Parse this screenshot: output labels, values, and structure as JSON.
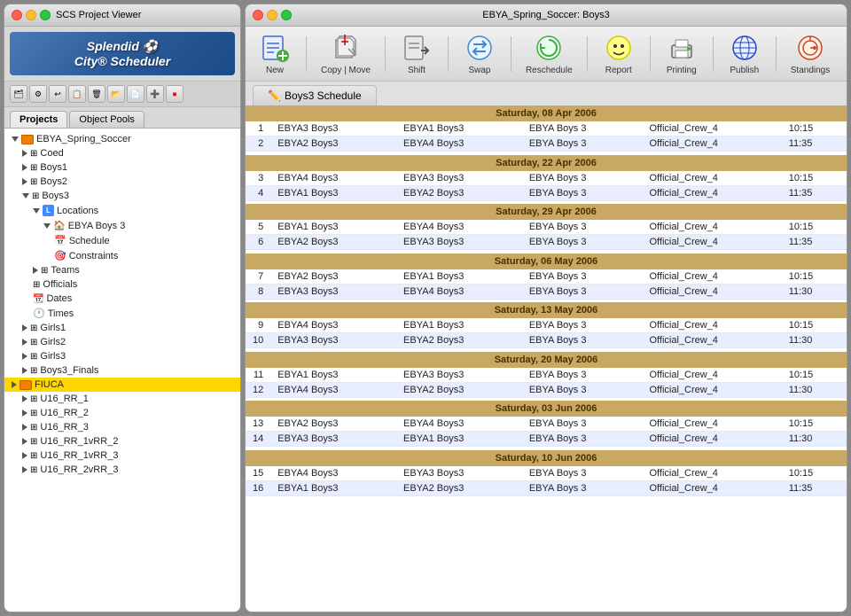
{
  "leftPanel": {
    "title": "SCS Project Viewer",
    "appName": "Splendid",
    "appName2": "City® Scheduler",
    "tabs": [
      "Projects",
      "Object Pools"
    ],
    "activeTab": "Projects",
    "tree": [
      {
        "id": "ebya",
        "label": "EBYA_Spring_Soccer",
        "indent": 1,
        "type": "folder-orange",
        "expanded": true,
        "triangle": "down"
      },
      {
        "id": "coed",
        "label": "Coed",
        "indent": 2,
        "type": "grid",
        "triangle": "right"
      },
      {
        "id": "boys1",
        "label": "Boys1",
        "indent": 2,
        "type": "grid",
        "triangle": "right"
      },
      {
        "id": "boys2",
        "label": "Boys2",
        "indent": 2,
        "type": "grid",
        "triangle": "right"
      },
      {
        "id": "boys3",
        "label": "Boys3",
        "indent": 2,
        "type": "grid",
        "triangle": "down",
        "expanded": true
      },
      {
        "id": "locations",
        "label": "Locations",
        "indent": 3,
        "type": "loc",
        "triangle": "down",
        "expanded": true
      },
      {
        "id": "ebya-boys3",
        "label": "EBYA Boys 3",
        "indent": 4,
        "type": "house",
        "triangle": "down",
        "expanded": true
      },
      {
        "id": "schedule",
        "label": "Schedule",
        "indent": 5,
        "type": "cal"
      },
      {
        "id": "constraints",
        "label": "Constraints",
        "indent": 5,
        "type": "dart"
      },
      {
        "id": "teams",
        "label": "Teams",
        "indent": 3,
        "type": "grid",
        "triangle": "right"
      },
      {
        "id": "officials",
        "label": "Officials",
        "indent": 3,
        "type": "grid"
      },
      {
        "id": "dates",
        "label": "Dates",
        "indent": 3,
        "type": "cal2"
      },
      {
        "id": "times",
        "label": "Times",
        "indent": 3,
        "type": "clock"
      },
      {
        "id": "girls1",
        "label": "Girls1",
        "indent": 2,
        "type": "grid",
        "triangle": "right"
      },
      {
        "id": "girls2",
        "label": "Girls2",
        "indent": 2,
        "type": "grid",
        "triangle": "right"
      },
      {
        "id": "girls3",
        "label": "Girls3",
        "indent": 2,
        "type": "grid",
        "triangle": "right"
      },
      {
        "id": "boys3f",
        "label": "Boys3_Finals",
        "indent": 2,
        "type": "grid",
        "triangle": "right"
      },
      {
        "id": "fiuca",
        "label": "FIUCA",
        "indent": 1,
        "type": "folder-orange",
        "triangle": "right",
        "selected": true
      },
      {
        "id": "u16rr1",
        "label": "U16_RR_1",
        "indent": 2,
        "type": "grid",
        "triangle": "right"
      },
      {
        "id": "u16rr2",
        "label": "U16_RR_2",
        "indent": 2,
        "type": "grid",
        "triangle": "right"
      },
      {
        "id": "u16rr3",
        "label": "U16_RR_3",
        "indent": 2,
        "type": "grid",
        "triangle": "right"
      },
      {
        "id": "u16rr1vrr2",
        "label": "U16_RR_1vRR_2",
        "indent": 2,
        "type": "grid",
        "triangle": "right"
      },
      {
        "id": "u16rr1vrr3",
        "label": "U16_RR_1vRR_3",
        "indent": 2,
        "type": "grid",
        "triangle": "right"
      },
      {
        "id": "u16rr2vrr3",
        "label": "U16_RR_2vRR_3",
        "indent": 2,
        "type": "grid",
        "triangle": "right"
      }
    ]
  },
  "rightPanel": {
    "title": "EBYA_Spring_Soccer: Boys3",
    "toolbar": [
      {
        "id": "new",
        "label": "New",
        "icon": "📋"
      },
      {
        "id": "copy",
        "label": "Copy | Move",
        "icon": "✂️"
      },
      {
        "id": "shift",
        "label": "Shift",
        "icon": "🔧"
      },
      {
        "id": "swap",
        "label": "Swap",
        "icon": "🔄"
      },
      {
        "id": "reschedule",
        "label": "Reschedule",
        "icon": "🔃"
      },
      {
        "id": "report",
        "label": "Report",
        "icon": "😊"
      },
      {
        "id": "printing",
        "label": "Printing",
        "icon": "🖨️"
      },
      {
        "id": "publish",
        "label": "Publish",
        "icon": "🌐"
      },
      {
        "id": "standings",
        "label": "Standings",
        "icon": "🔍"
      }
    ],
    "scheduleTab": "Boys3 Schedule",
    "dateGroups": [
      {
        "date": "Saturday, 08 Apr 2006",
        "games": [
          {
            "num": "1",
            "home": "EBYA3 Boys3",
            "away": "EBYA1 Boys3",
            "location": "EBYA Boys 3",
            "crew": "Official_Crew_4",
            "time": "10:15"
          },
          {
            "num": "2",
            "home": "EBYA2 Boys3",
            "away": "EBYA4 Boys3",
            "location": "EBYA Boys 3",
            "crew": "Official_Crew_4",
            "time": "11:35"
          }
        ]
      },
      {
        "date": "Saturday, 22 Apr 2006",
        "games": [
          {
            "num": "3",
            "home": "EBYA4 Boys3",
            "away": "EBYA3 Boys3",
            "location": "EBYA Boys 3",
            "crew": "Official_Crew_4",
            "time": "10:15"
          },
          {
            "num": "4",
            "home": "EBYA1 Boys3",
            "away": "EBYA2 Boys3",
            "location": "EBYA Boys 3",
            "crew": "Official_Crew_4",
            "time": "11:35"
          }
        ]
      },
      {
        "date": "Saturday, 29 Apr 2006",
        "games": [
          {
            "num": "5",
            "home": "EBYA1 Boys3",
            "away": "EBYA4 Boys3",
            "location": "EBYA Boys 3",
            "crew": "Official_Crew_4",
            "time": "10:15"
          },
          {
            "num": "6",
            "home": "EBYA2 Boys3",
            "away": "EBYA3 Boys3",
            "location": "EBYA Boys 3",
            "crew": "Official_Crew_4",
            "time": "11:35"
          }
        ]
      },
      {
        "date": "Saturday, 06 May 2006",
        "games": [
          {
            "num": "7",
            "home": "EBYA2 Boys3",
            "away": "EBYA1 Boys3",
            "location": "EBYA Boys 3",
            "crew": "Official_Crew_4",
            "time": "10:15"
          },
          {
            "num": "8",
            "home": "EBYA3 Boys3",
            "away": "EBYA4 Boys3",
            "location": "EBYA Boys 3",
            "crew": "Official_Crew_4",
            "time": "11:30"
          }
        ]
      },
      {
        "date": "Saturday, 13 May 2006",
        "games": [
          {
            "num": "9",
            "home": "EBYA4 Boys3",
            "away": "EBYA1 Boys3",
            "location": "EBYA Boys 3",
            "crew": "Official_Crew_4",
            "time": "10:15"
          },
          {
            "num": "10",
            "home": "EBYA3 Boys3",
            "away": "EBYA2 Boys3",
            "location": "EBYA Boys 3",
            "crew": "Official_Crew_4",
            "time": "11:30"
          }
        ]
      },
      {
        "date": "Saturday, 20 May 2006",
        "games": [
          {
            "num": "11",
            "home": "EBYA1 Boys3",
            "away": "EBYA3 Boys3",
            "location": "EBYA Boys 3",
            "crew": "Official_Crew_4",
            "time": "10:15"
          },
          {
            "num": "12",
            "home": "EBYA4 Boys3",
            "away": "EBYA2 Boys3",
            "location": "EBYA Boys 3",
            "crew": "Official_Crew_4",
            "time": "11:30"
          }
        ]
      },
      {
        "date": "Saturday, 03 Jun 2006",
        "games": [
          {
            "num": "13",
            "home": "EBYA2 Boys3",
            "away": "EBYA4 Boys3",
            "location": "EBYA Boys 3",
            "crew": "Official_Crew_4",
            "time": "10:15"
          },
          {
            "num": "14",
            "home": "EBYA3 Boys3",
            "away": "EBYA1 Boys3",
            "location": "EBYA Boys 3",
            "crew": "Official_Crew_4",
            "time": "11:30"
          }
        ]
      },
      {
        "date": "Saturday, 10 Jun 2006",
        "games": [
          {
            "num": "15",
            "home": "EBYA4 Boys3",
            "away": "EBYA3 Boys3",
            "location": "EBYA Boys 3",
            "crew": "Official_Crew_4",
            "time": "10:15"
          },
          {
            "num": "16",
            "home": "EBYA1 Boys3",
            "away": "EBYA2 Boys3",
            "location": "EBYA Boys 3",
            "crew": "Official_Crew_4",
            "time": "11:35"
          }
        ]
      }
    ]
  }
}
